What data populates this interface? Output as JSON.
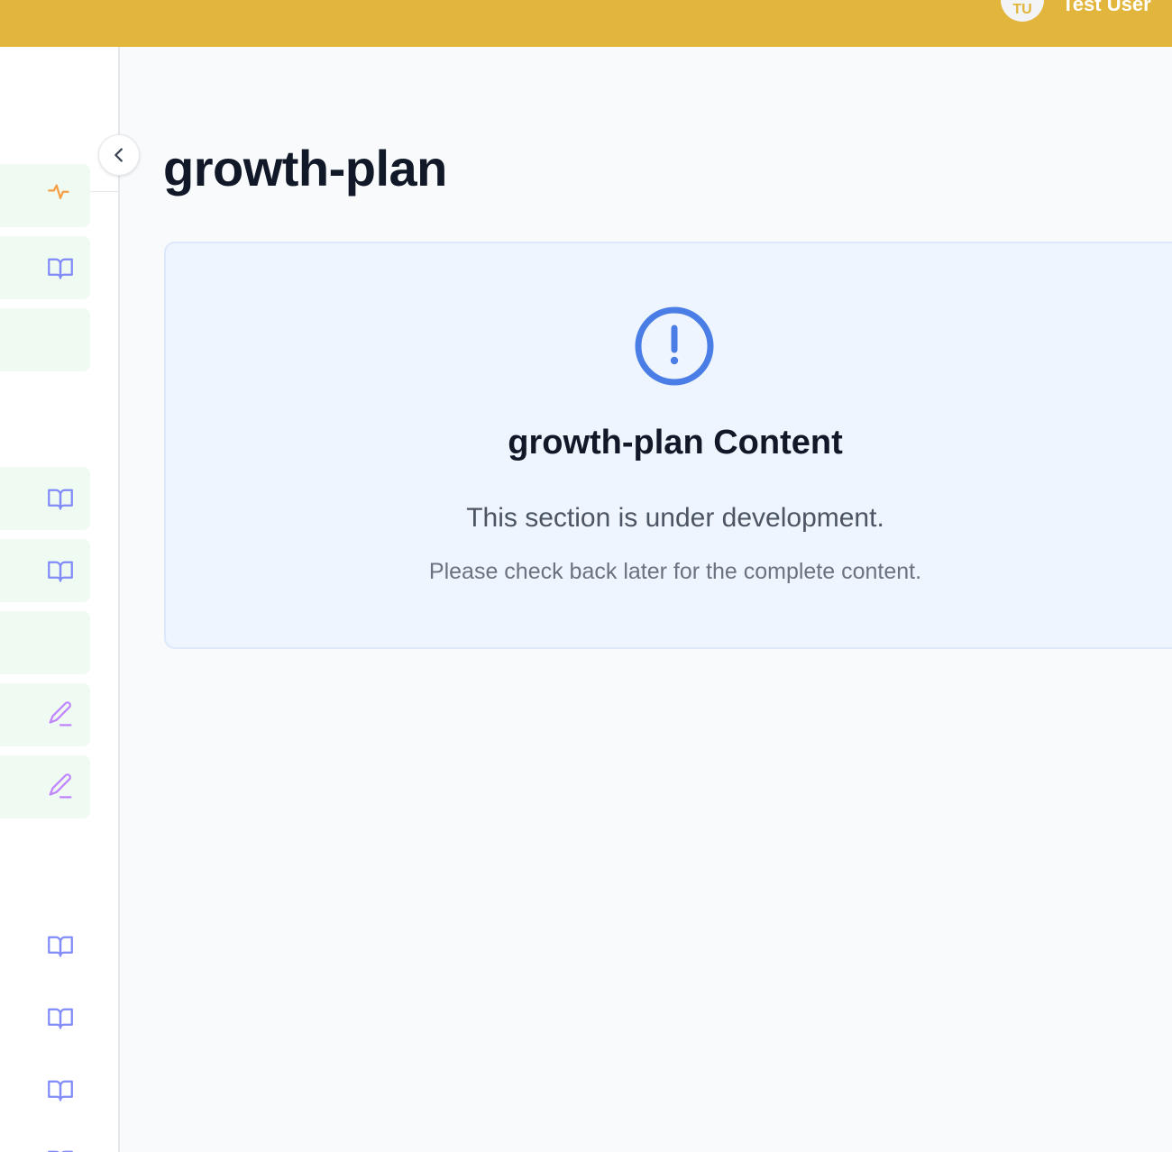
{
  "header": {
    "avatar_initials": "TU",
    "user_name": "Test User",
    "bar_color": "#e2b53c"
  },
  "sidebar": {
    "items": [
      {
        "icon": "activity-icon",
        "color": "#f59e42",
        "highlighted": true
      },
      {
        "icon": "book-open-icon",
        "color": "#818cf8",
        "highlighted": true
      },
      {
        "icon": "none",
        "highlighted": true
      },
      {
        "icon": "book-open-icon",
        "color": "#818cf8",
        "highlighted": true
      },
      {
        "icon": "book-open-icon",
        "color": "#818cf8",
        "highlighted": true
      },
      {
        "icon": "none",
        "highlighted": true
      },
      {
        "icon": "pen-icon",
        "color": "#c084fc",
        "highlighted": true
      },
      {
        "icon": "pen-icon",
        "color": "#c084fc",
        "highlighted": true
      },
      {
        "icon": "book-open-icon",
        "color": "#818cf8",
        "highlighted": false
      },
      {
        "icon": "book-open-icon",
        "color": "#818cf8",
        "highlighted": false
      },
      {
        "icon": "book-open-icon",
        "color": "#818cf8",
        "highlighted": false
      },
      {
        "icon": "book-open-icon",
        "color": "#818cf8",
        "highlighted": false
      }
    ],
    "collapse_icon": "chevron-left-icon"
  },
  "main": {
    "title": "growth-plan",
    "card": {
      "icon": "alert-circle-icon",
      "accent_color": "#4a7ee6",
      "heading": "growth-plan Content",
      "text": "This section is under development.",
      "subtext": "Please check back later for the complete content."
    }
  }
}
